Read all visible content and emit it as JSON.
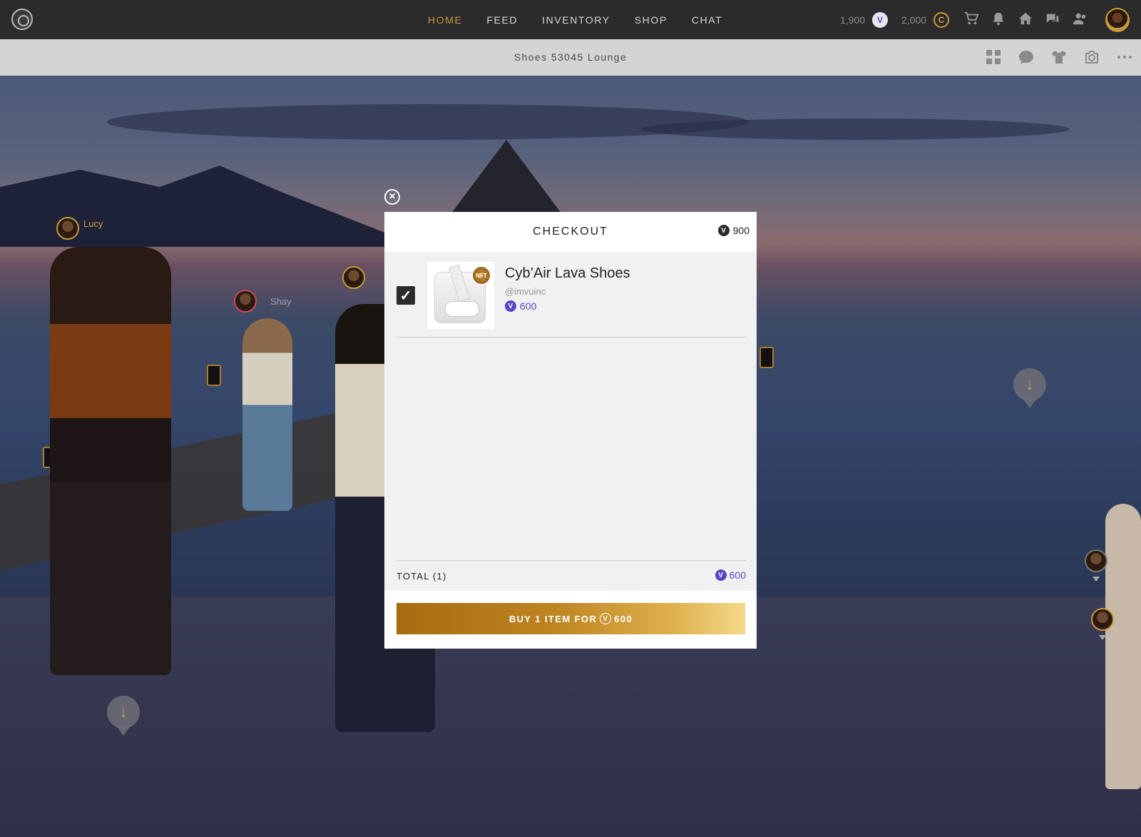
{
  "nav": {
    "items": [
      "HOME",
      "FEED",
      "INVENTORY",
      "SHOP",
      "CHAT"
    ],
    "active": "HOME"
  },
  "currency": {
    "vcoin_balance": "1,900",
    "credits_balance": "2,000",
    "vcoin_icon": "vcoin-icon",
    "credits_icon": "credits-icon",
    "credits_glyph": "C",
    "vcoin_glyph": "V"
  },
  "room": {
    "title": "Shoes 53045 Lounge"
  },
  "scene": {
    "users": [
      {
        "name": "Lucy"
      },
      {
        "name": "Shay"
      }
    ]
  },
  "checkout": {
    "title": "CHECKOUT",
    "balance": "900",
    "item": {
      "name": "Cyb’Air Lava Shoes",
      "creator": "@imvuinc",
      "price": "600",
      "badge": "NFT",
      "checked": true
    },
    "total_label": "TOTAL (1)",
    "total_value": "600",
    "buy_label": "BUY 1 ITEM FOR",
    "buy_value": "600"
  },
  "colors": {
    "accent_gold": "#c69a3a",
    "vcoin_purple": "#5b43c9",
    "topbar": "#2b2b2b"
  }
}
